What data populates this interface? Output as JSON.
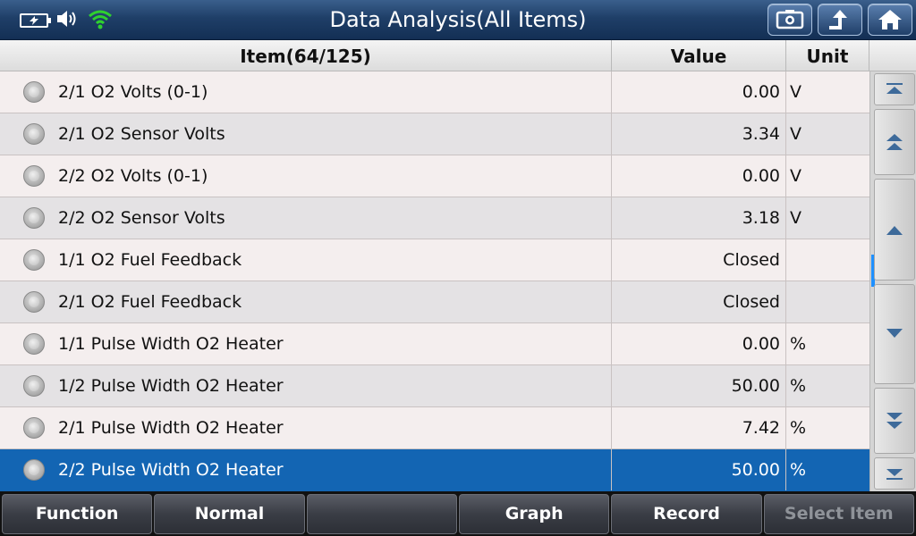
{
  "title": "Data Analysis(All Items)",
  "icons": {
    "battery": "battery-charging-icon",
    "volume": "speaker-icon",
    "wifi": "wifi-icon",
    "title_buttons": [
      "screenshot-icon",
      "back-icon",
      "home-icon"
    ]
  },
  "colors": {
    "accent": "#1365b3",
    "wifi": "#2fd12f",
    "title_bg": "#1f3f68"
  },
  "table": {
    "headers": {
      "item": "Item(64/125)",
      "value": "Value",
      "unit": "Unit"
    },
    "rows": [
      {
        "item": "2/1 O2 Volts (0-1)",
        "value": "0.00",
        "unit": "V"
      },
      {
        "item": "2/1 O2 Sensor Volts",
        "value": "3.34",
        "unit": "V"
      },
      {
        "item": "2/2 O2 Volts (0-1)",
        "value": "0.00",
        "unit": "V"
      },
      {
        "item": "2/2 O2 Sensor Volts",
        "value": "3.18",
        "unit": "V"
      },
      {
        "item": "1/1 O2 Fuel Feedback",
        "value": "Closed",
        "unit": ""
      },
      {
        "item": "2/1 O2 Fuel Feedback",
        "value": "Closed",
        "unit": ""
      },
      {
        "item": "1/1 Pulse Width O2 Heater",
        "value": "0.00",
        "unit": "%"
      },
      {
        "item": "1/2 Pulse Width O2 Heater",
        "value": "50.00",
        "unit": "%"
      },
      {
        "item": "2/1 Pulse Width O2 Heater",
        "value": "7.42",
        "unit": "%"
      },
      {
        "item": "2/2 Pulse Width O2 Heater",
        "value": "50.00",
        "unit": "%"
      }
    ],
    "selected_index": 9
  },
  "scrollbar": {
    "buttons": [
      "scroll-top-icon",
      "page-up-icon",
      "line-up-icon",
      "line-down-icon",
      "page-down-icon",
      "scroll-bottom-icon"
    ]
  },
  "toolbar": {
    "function": "Function",
    "normal": "Normal",
    "blank": "",
    "graph": "Graph",
    "record": "Record",
    "select_item": "Select Item"
  }
}
